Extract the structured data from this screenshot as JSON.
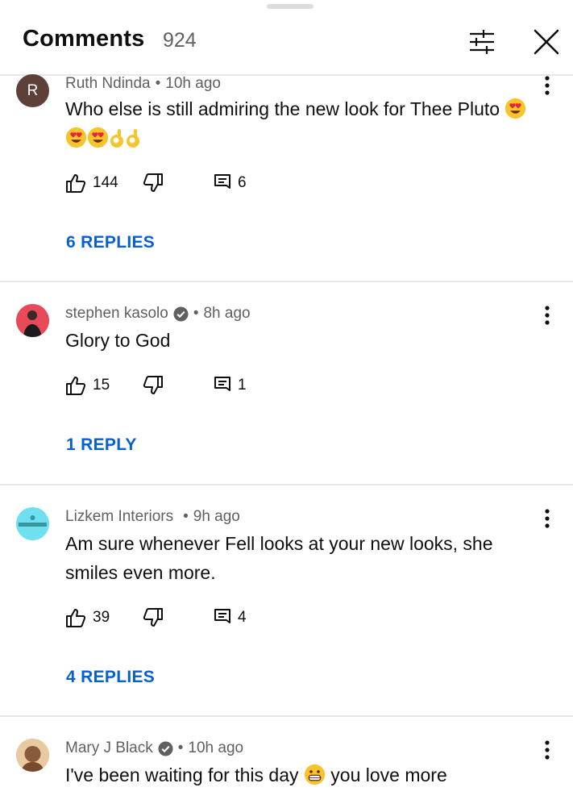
{
  "header": {
    "title": "Comments",
    "count": "924"
  },
  "colors": {
    "link": "#065fd4",
    "secondary_text": "#606060",
    "divider": "#e8e8e8"
  },
  "comments": [
    {
      "author": "Ruth Ndinda",
      "time": "10h ago",
      "avatar_letter": "R",
      "text": "Who else is still admiring the new look for Thee Pluto",
      "likes": "144",
      "reply_count": "6",
      "replies_label": "6 REPLIES",
      "emojis": [
        "heart-eyes",
        "heart-eyes",
        "heart-eyes",
        "ok-hand",
        "ok-hand"
      ]
    },
    {
      "author": "stephen kasolo",
      "verified": true,
      "time": "8h ago",
      "text": "Glory to God",
      "likes": "15",
      "reply_count": "1",
      "replies_label": "1 REPLY"
    },
    {
      "author": "Lizkem Interiors",
      "time": "9h ago",
      "text": "Am sure whenever Fell looks at your new looks, she smiles even more.",
      "likes": "39",
      "reply_count": "4",
      "replies_label": "4 REPLIES"
    },
    {
      "author": "Mary J Black",
      "verified": true,
      "time": "10h ago",
      "text_before_emoji": "I've been waiting for this day",
      "text_after_emoji": "you love more",
      "emoji": "grinning"
    }
  ]
}
